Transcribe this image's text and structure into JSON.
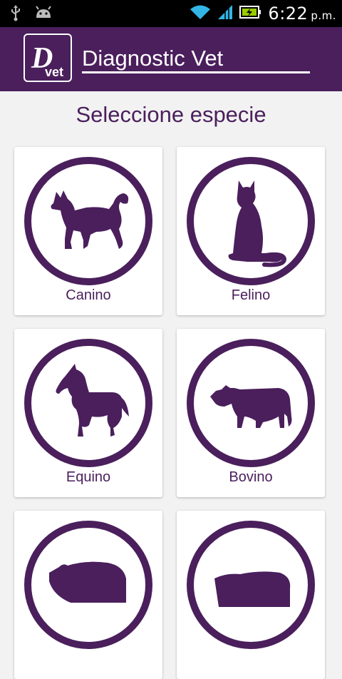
{
  "status_bar": {
    "time": "6:22",
    "ampm": "p.m.",
    "icons": [
      "usb-icon",
      "android-icon",
      "wifi-icon",
      "signal-icon",
      "battery-charging-icon"
    ]
  },
  "app_bar": {
    "logo_text_main": "D",
    "logo_text_sub": "vet",
    "title": "Diagnostic Vet"
  },
  "main": {
    "heading": "Seleccione especie",
    "species": [
      {
        "label": "Canino",
        "icon": "dog-icon"
      },
      {
        "label": "Felino",
        "icon": "cat-icon"
      },
      {
        "label": "Equino",
        "icon": "horse-icon"
      },
      {
        "label": "Bovino",
        "icon": "cow-icon"
      },
      {
        "label": "",
        "icon": "pig-icon"
      },
      {
        "label": "",
        "icon": "sheep-icon"
      }
    ]
  },
  "colors": {
    "primary": "#4a1f5c",
    "background": "#f2f2f2",
    "card": "#ffffff"
  }
}
